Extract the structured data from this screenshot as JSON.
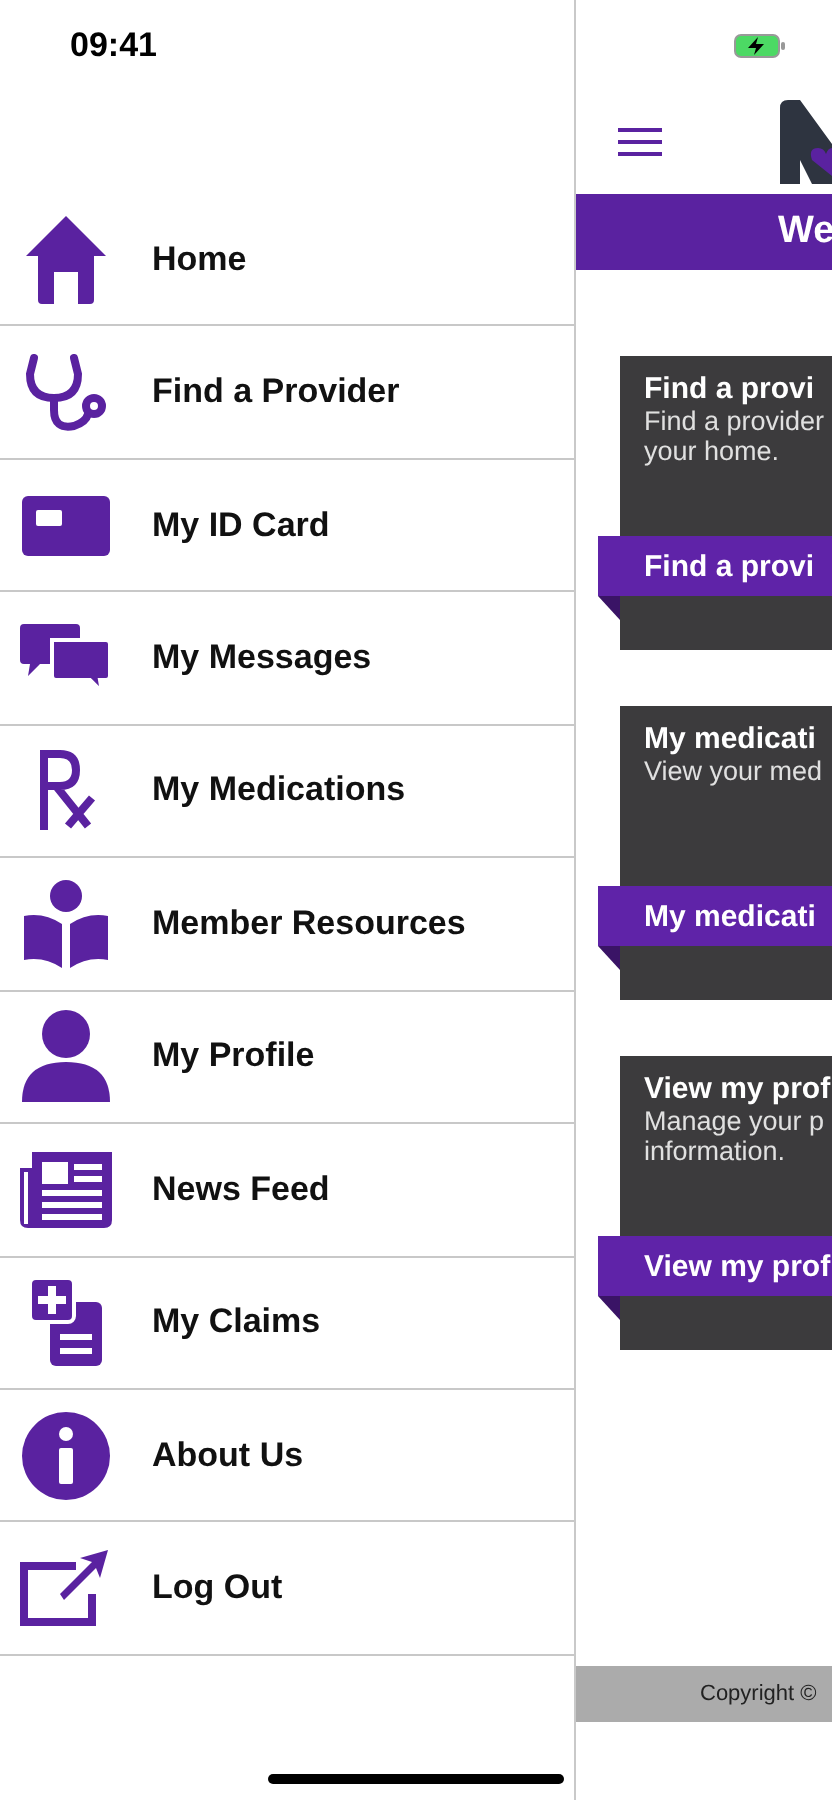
{
  "status_bar": {
    "time": "09:41"
  },
  "menu": [
    {
      "label": "Home"
    },
    {
      "label": "Find a Provider"
    },
    {
      "label": "My ID Card"
    },
    {
      "label": "My Messages"
    },
    {
      "label": "My Medications"
    },
    {
      "label": "Member Resources"
    },
    {
      "label": "My Profile"
    },
    {
      "label": "News Feed"
    },
    {
      "label": "My Claims"
    },
    {
      "label": "About Us"
    },
    {
      "label": "Log Out"
    }
  ],
  "main": {
    "banner": "We",
    "cards": [
      {
        "title": "Find a provi",
        "description": [
          "Find a provider",
          "your home."
        ],
        "action": "Find a provi"
      },
      {
        "title": "My medicati",
        "description": [
          "View your med"
        ],
        "action": "My medicati"
      },
      {
        "title": "View my prof",
        "description": [
          "Manage your p",
          "information."
        ],
        "action": "View my prof"
      }
    ],
    "footer": "Copyright ©"
  }
}
